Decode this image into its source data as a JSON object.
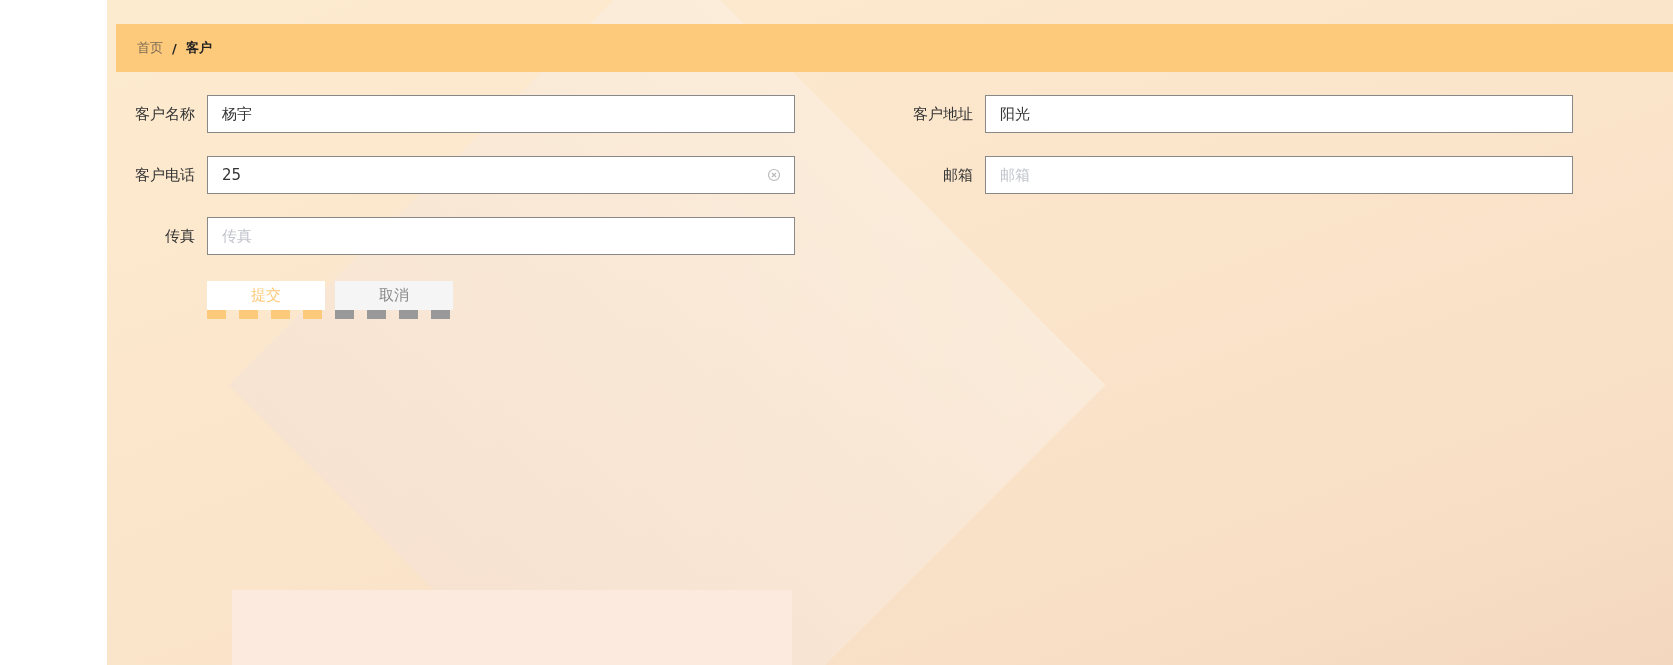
{
  "breadcrumb": [
    {
      "label": "首页",
      "current": false
    },
    {
      "label": "/",
      "kind": "separator"
    },
    {
      "label": "客户",
      "current": true
    }
  ],
  "form_rows": [
    {
      "fields": [
        {
          "label": "客户名称",
          "value": "杨宇",
          "clearable": false
        },
        {
          "label": "客户地址",
          "value": "阳光",
          "clearable": false
        }
      ]
    },
    {
      "fields": [
        {
          "label": "客户电话",
          "value": "25",
          "clearable": true
        },
        {
          "label": "邮箱",
          "placeholder": "邮箱",
          "clearable": false
        }
      ]
    },
    {
      "fields": [
        {
          "label": "传真",
          "placeholder": "传真",
          "clearable": false
        }
      ]
    }
  ],
  "buttons": [
    {
      "label": "提交",
      "kind": "primary"
    },
    {
      "label": "取消",
      "kind": "default"
    }
  ]
}
